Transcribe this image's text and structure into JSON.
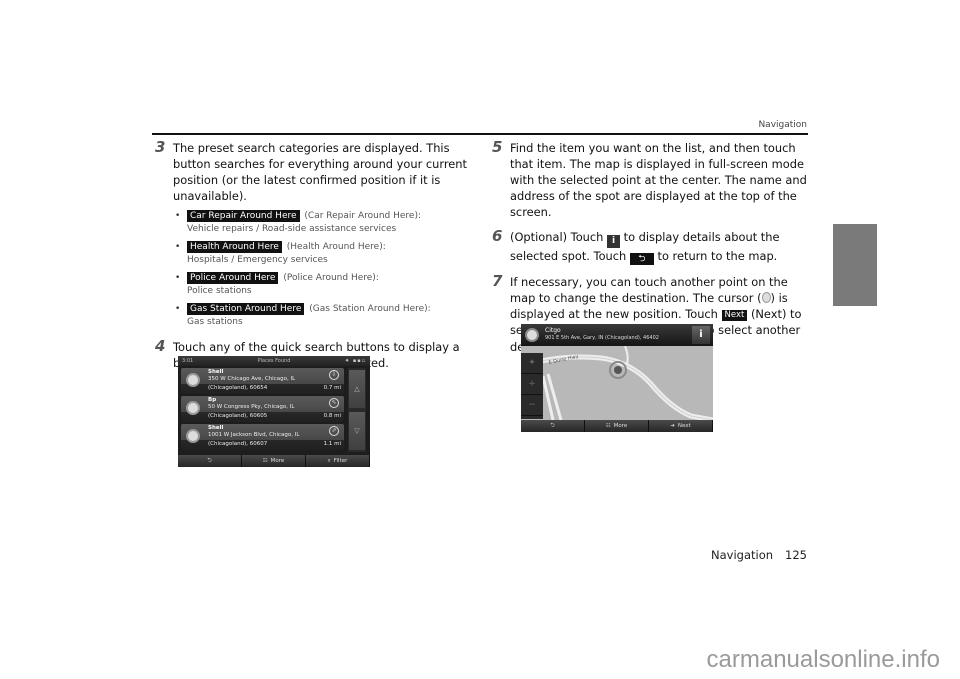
{
  "header": {
    "section": "Navigation"
  },
  "left": {
    "step3": {
      "num": "3",
      "text": "The preset search categories are displayed. This button searches for everything around your current position (or the latest confirmed position if it is unavailable).",
      "bullets": [
        {
          "chip": "Car Repair Around Here",
          "label": "(Car Repair Around Here):",
          "desc": "Vehicle repairs / Road-side assistance services"
        },
        {
          "chip": "Health Around Here",
          "label": "(Health Around Here):",
          "desc": "Hospitals / Emergency services"
        },
        {
          "chip": "Police Around Here",
          "label": "(Police Around Here):",
          "desc": "Police stations"
        },
        {
          "chip": "Gas Station Around Here",
          "label": "(Gas Station Around Here):",
          "desc": "Gas stations"
        }
      ]
    },
    "step4": {
      "num": "4",
      "text": "Touch any of the quick search buttons to display a basic list for the service you selected."
    }
  },
  "places_screen": {
    "time": "3:01",
    "title": "Places Found",
    "status": "✷ ▪▪▫",
    "items": [
      {
        "name": "Shell",
        "addr1": "350 W Chicago Ave, Chicago, IL",
        "addr2": "(Chicagoland), 60654",
        "distance": "0.7 mi",
        "dir": "⇩"
      },
      {
        "name": "Bp",
        "addr1": "50 W Congress Pky, Chicago, IL",
        "addr2": "(Chicagoland), 60605",
        "distance": "0.8 mi",
        "dir": "⇖"
      },
      {
        "name": "Shell",
        "addr1": "1001 W Jackson Blvd, Chicago, IL",
        "addr2": "(Chicagoland), 60607",
        "distance": "1.1 mi",
        "dir": "⇗"
      }
    ],
    "scroll_up": "△",
    "scroll_down": "▽",
    "buttons": {
      "back": "⮌",
      "more": "More",
      "more_icon": "☷",
      "filter": "Filter",
      "filter_icon": "⌕"
    }
  },
  "right": {
    "step5": {
      "num": "5",
      "text": "Find the item you want on the list, and then touch that item. The map is displayed in full-screen mode with the selected point at the center. The name and address of the spot are displayed at the top of the screen."
    },
    "step6": {
      "num": "6",
      "pre": "(Optional) Touch",
      "info_icon": "i",
      "mid": "to display details about the selected spot. Touch",
      "back_icon": "⮌",
      "post": "to return to the map."
    },
    "step7": {
      "num": "7",
      "pre": "If necessary, you can touch another point on the map to change the destination. The cursor (",
      "mid1": ") is displayed at the new position. Touch",
      "next_chip": "Next",
      "mid2": "(Next) to set the destination, or touch",
      "back_icon": "⮌",
      "post": "to select another destination."
    }
  },
  "map_screen": {
    "name": "Citgo",
    "address": "901 E 5th Ave, Gary, IN (Chicagoland), 46402",
    "info": "i",
    "road_label": "E Dune Hwy",
    "controls": [
      "✦",
      "+",
      "−"
    ],
    "buttons": {
      "back": "⮌",
      "more": "More",
      "more_icon": "☷",
      "next": "Next",
      "next_icon": "➔"
    }
  },
  "footer": {
    "section": "Navigation",
    "page": "125"
  },
  "watermark": "carmanualsonline.info"
}
